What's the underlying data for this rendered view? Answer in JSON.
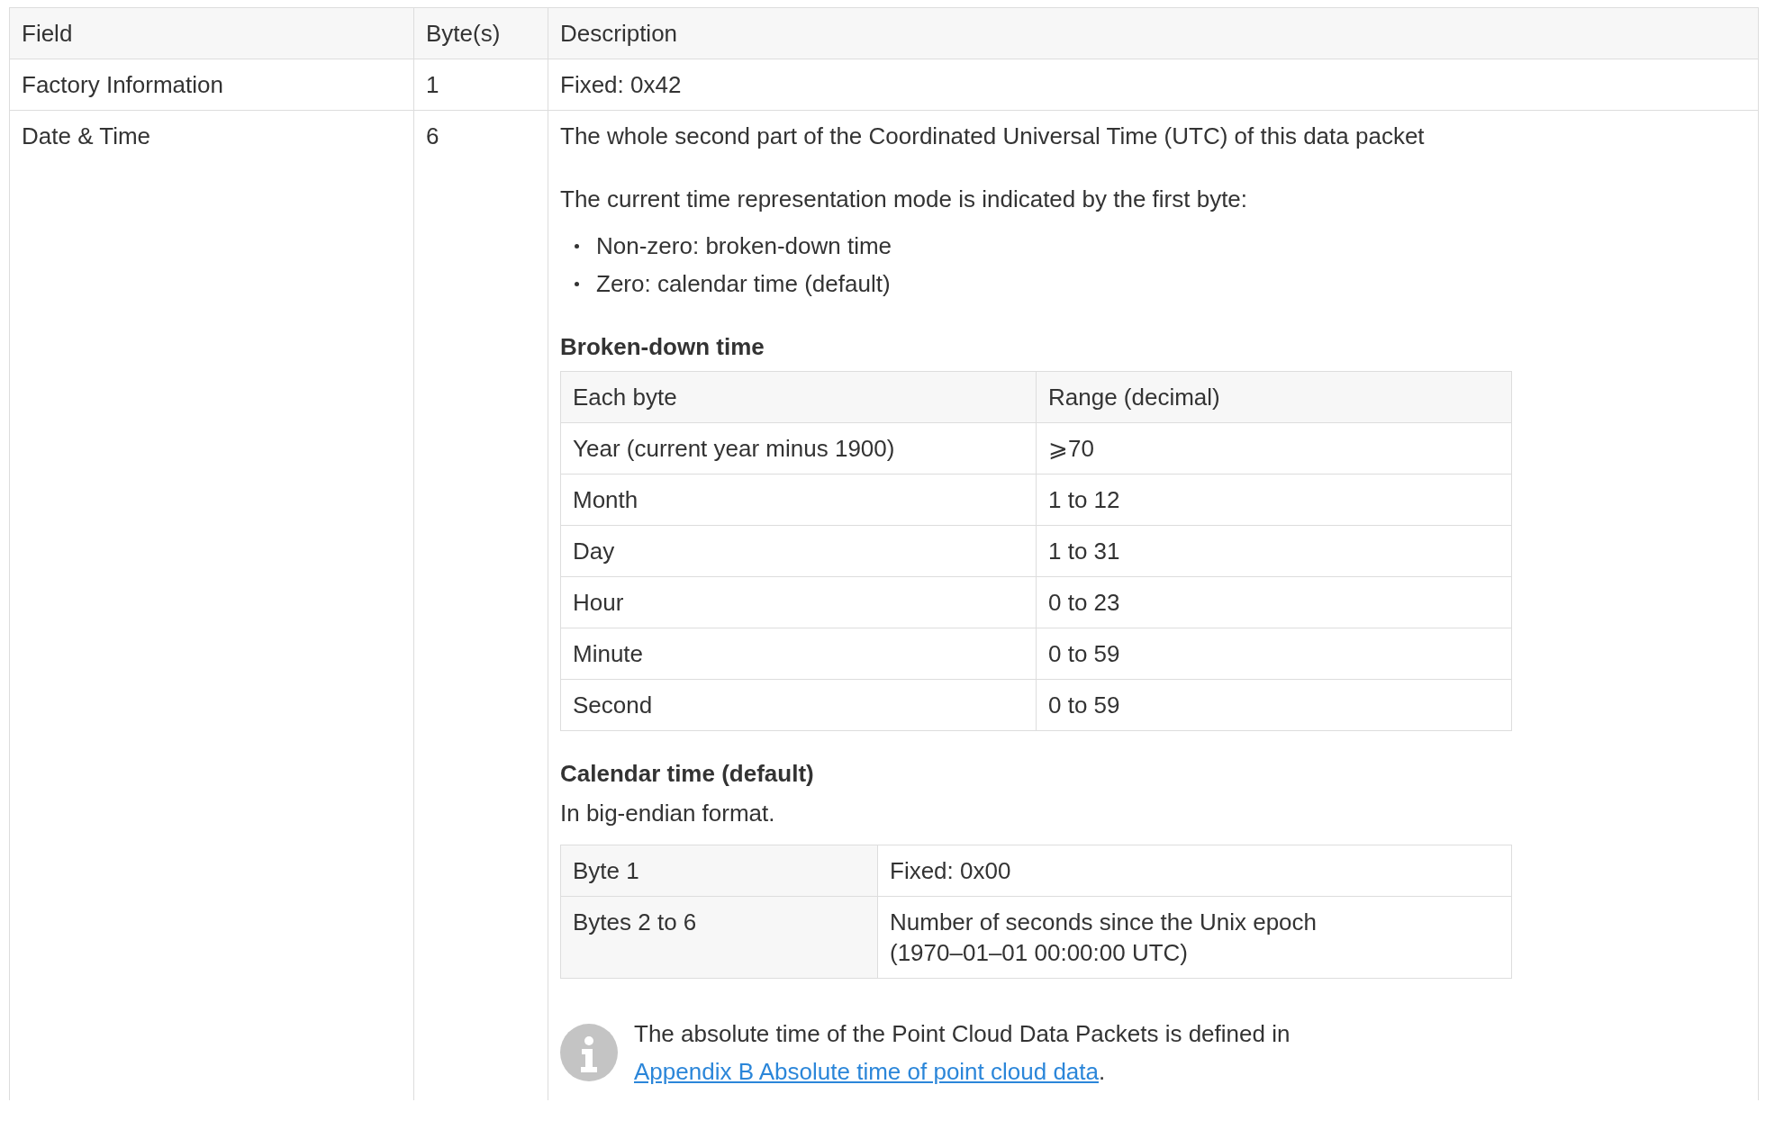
{
  "table": {
    "columns": [
      "Field",
      "Byte(s)",
      "Description"
    ],
    "rows": [
      {
        "field": "Factory Information",
        "bytes": "1",
        "description": [
          {
            "kind": "paragraph",
            "text": "Fixed: 0x42"
          }
        ]
      },
      {
        "field": "Date & Time",
        "bytes": "6",
        "description": [
          {
            "kind": "paragraph",
            "text": "The whole second part of the Coordinated Universal Time (UTC) of this data packet"
          },
          {
            "kind": "paragraph",
            "text": "The current time representation mode is indicated by the first byte:"
          },
          {
            "kind": "bullets",
            "items": [
              "Non-zero: broken-down time",
              "Zero: calendar time (default)"
            ]
          },
          {
            "kind": "heading",
            "text": "Broken-down time"
          },
          {
            "kind": "table",
            "columns": [
              "Each byte",
              "Range (decimal)"
            ],
            "rows": [
              [
                "Year (current year minus 1900)",
                "⩾70"
              ],
              [
                "Month",
                "1 to 12"
              ],
              [
                "Day",
                "1 to 31"
              ],
              [
                "Hour",
                "0 to 23"
              ],
              [
                "Minute",
                "0 to 59"
              ],
              [
                "Second",
                "0 to 59"
              ]
            ]
          },
          {
            "kind": "heading",
            "text": "Calendar time (default)"
          },
          {
            "kind": "paragraph",
            "text": "In big-endian format."
          },
          {
            "kind": "table",
            "rows": [
              [
                "Byte 1",
                "Fixed: 0x00"
              ],
              [
                "Bytes 2 to 6",
                "Number of seconds since the Unix epoch\n(1970–01–01 00:00:00 UTC)"
              ]
            ]
          },
          {
            "kind": "note",
            "text": "The absolute time of the Point Cloud Data Packets is defined in ",
            "link": "Appendix B Absolute time of point cloud data",
            "after": "."
          }
        ]
      }
    ]
  }
}
